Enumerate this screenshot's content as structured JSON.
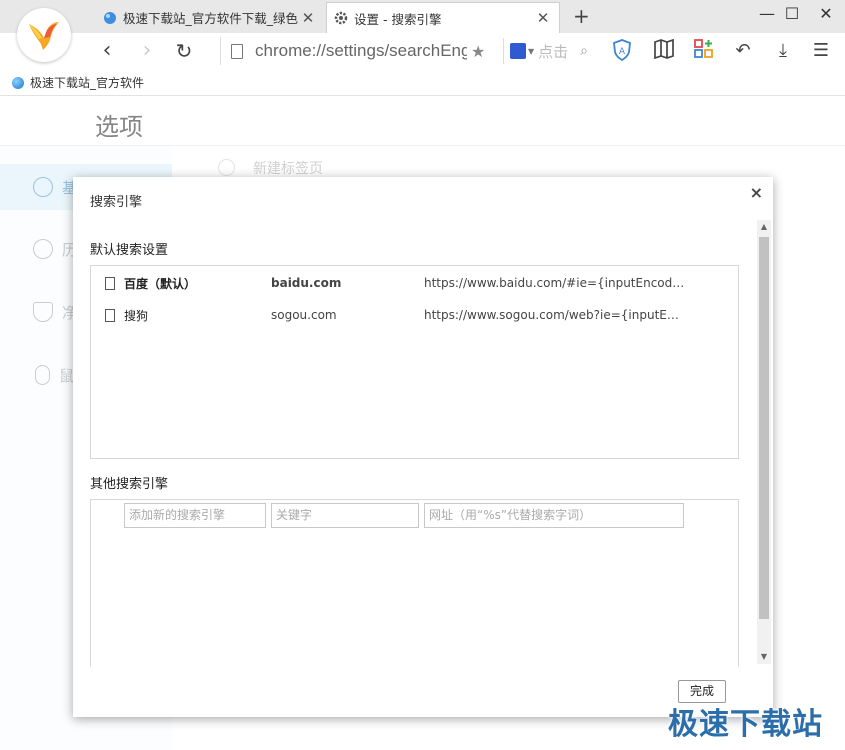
{
  "browser": {
    "tabs": [
      {
        "title": "极速下载站_官方软件下载_绿色软件",
        "active": false
      },
      {
        "title": "设置 - 搜索引擎",
        "active": true
      }
    ],
    "new_tab_symbol": "+",
    "window_controls": {
      "minimize": "—",
      "maximize": "☐",
      "close": "✕"
    },
    "address": "chrome://settings/searchEngines",
    "search_placeholder": "点击",
    "bookmark": "极速下载站_官方软件"
  },
  "settings": {
    "title": "选项",
    "sidebar": [
      {
        "label": "基",
        "icon": "gear-icon",
        "active": true
      },
      {
        "label": "历",
        "icon": "clock-icon",
        "active": false
      },
      {
        "label": "净",
        "icon": "shield-icon",
        "active": false
      },
      {
        "label": "鼠",
        "icon": "mouse-icon",
        "active": false
      }
    ],
    "background_option": "新建标签页"
  },
  "dialog": {
    "title": "搜索引擎",
    "close_symbol": "×",
    "default_section": "默认搜索设置",
    "default_engines": [
      {
        "name": "百度（默认）",
        "keyword": "baidu.com",
        "url": "https://www.baidu.com/#ie={inputEncoding}&wd=%s",
        "default": true
      },
      {
        "name": "搜狗",
        "keyword": "sogou.com",
        "url": "https://www.sogou.com/web?ie={inputEncoding}&query=%s",
        "default": false
      }
    ],
    "other_section": "其他搜索引擎",
    "add_fields": {
      "name_placeholder": "添加新的搜索引擎",
      "keyword_placeholder": "关键字",
      "url_placeholder": "网址（用“%s”代替搜索字词）"
    },
    "done_label": "完成"
  },
  "watermark": "极速下载站",
  "colors": {
    "accent": "#4a90c9",
    "sidebar_active_bg": "#d9eefa",
    "watermark": "#2b6ea9"
  }
}
